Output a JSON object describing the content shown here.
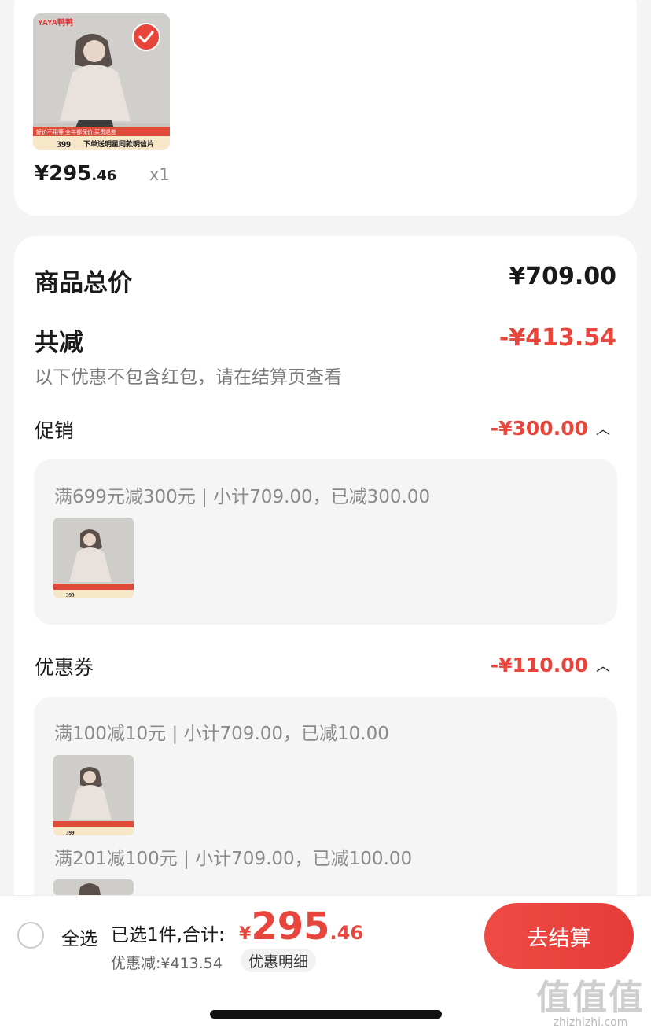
{
  "product": {
    "brand": "YAYA鸭鸭",
    "price_int": "¥295",
    "price_dec": ".46",
    "qty": "x1",
    "banner_left": "好价不用等 全年都保价 买贵退差",
    "banner_price": "399",
    "banner_right": "下单送明星同款明信片"
  },
  "summary": {
    "total_label": "商品总价",
    "total_value": "¥709.00",
    "reduce_label": "共减",
    "reduce_value": "-¥413.54",
    "note": "以下优惠不包含红包，请在结算页查看"
  },
  "promotion": {
    "label": "促销",
    "value": "-¥300.00",
    "line": "满699元减300元 | 小计709.00，已减300.00"
  },
  "coupon": {
    "label": "优惠券",
    "value": "-¥110.00",
    "line1": "满100减10元 | 小计709.00，已减10.00",
    "line2": "满201减100元 | 小计709.00，已减100.00"
  },
  "bottom": {
    "select_all": "全选",
    "selected": "已选1件,合计:",
    "sum_yen": "¥",
    "sum_int": "295",
    "sum_dec": ".46",
    "discount": "优惠减:¥413.54",
    "detail": "优惠明细",
    "checkout": "去结算"
  },
  "watermark": {
    "big": "值值值",
    "small": "zhizhizhi.com"
  },
  "colors": {
    "accent": "#e8453c",
    "bg": "#f4f4f4"
  }
}
